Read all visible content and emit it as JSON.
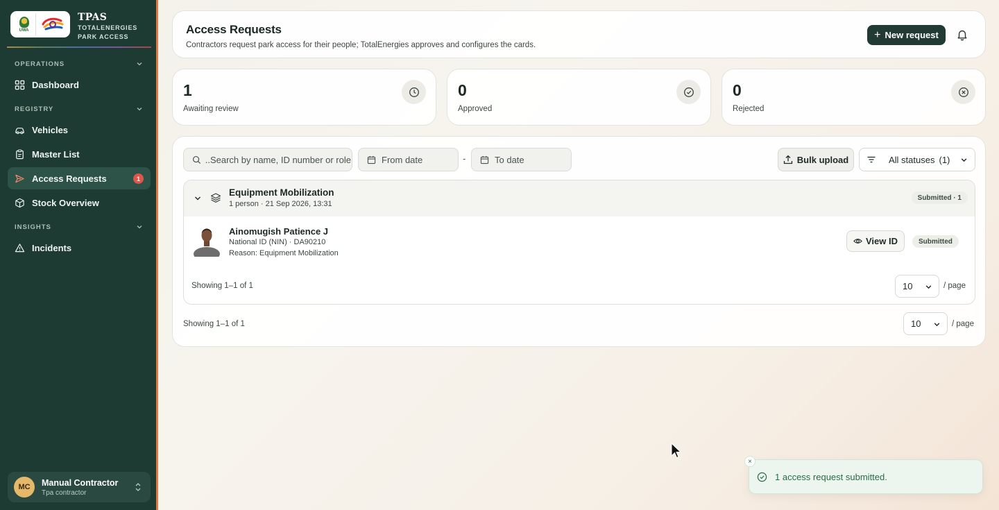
{
  "brand": {
    "logo_uwa_text": "UWA",
    "name": "TPAS",
    "subtitle_line1": "TOTALENERGIES",
    "subtitle_line2": "PARK ACCESS"
  },
  "sidebar": {
    "sections": [
      {
        "label": "OPERATIONS"
      },
      {
        "label": "REGISTRY"
      },
      {
        "label": "INSIGHTS"
      }
    ],
    "items": [
      {
        "label": "Dashboard",
        "icon": "grid-icon"
      },
      {
        "label": "Vehicles",
        "icon": "car-icon"
      },
      {
        "label": "Master List",
        "icon": "clipboard-icon"
      },
      {
        "label": "Access Requests",
        "icon": "send-icon",
        "badge": "1",
        "active": true
      },
      {
        "label": "Stock Overview",
        "icon": "box-icon"
      },
      {
        "label": "Incidents",
        "icon": "warning-icon"
      }
    ],
    "user": {
      "initials": "MC",
      "name": "Manual Contractor",
      "role": "Tpa contractor"
    }
  },
  "header": {
    "title": "Access Requests",
    "subtitle": "Contractors request park access for their people; TotalEnergies approves and configures the cards.",
    "new_request_label": "New request"
  },
  "stats": [
    {
      "value": "1",
      "label": "Awaiting review",
      "icon": "clock-icon"
    },
    {
      "value": "0",
      "label": "Approved",
      "icon": "check-circle-icon"
    },
    {
      "value": "0",
      "label": "Rejected",
      "icon": "x-circle-icon"
    }
  ],
  "filters": {
    "search_placeholder": "Search by name, ID number or role...",
    "from_date_placeholder": "From date",
    "separator": "-",
    "to_date_placeholder": "To date",
    "bulk_upload_label": "Bulk upload",
    "status_label": "All statuses",
    "status_count": "(1)"
  },
  "group": {
    "title": "Equipment Mobilization",
    "meta": "1 person · 21 Sep 2026, 13:31",
    "status": "Submitted · 1",
    "person": {
      "name": "Ainomugish Patience J",
      "id_line": "National ID (NIN) · DA90210",
      "reason": "Reason: Equipment Mobilization",
      "view_label": "View ID",
      "status": "Submitted"
    },
    "showing": "Showing 1–1 of 1",
    "page_size": "10",
    "per_page": "/ page"
  },
  "footer": {
    "showing": "Showing 1–1 of 1",
    "page_size": "10",
    "per_page": "/ page"
  },
  "toast": {
    "message": "1 access request submitted.",
    "close": "×"
  },
  "colors": {
    "sidebar_bg": "#1d3b33",
    "accent_dark": "#213a33",
    "badge_red": "#e0554a",
    "toast_green": "#2a6b45"
  }
}
